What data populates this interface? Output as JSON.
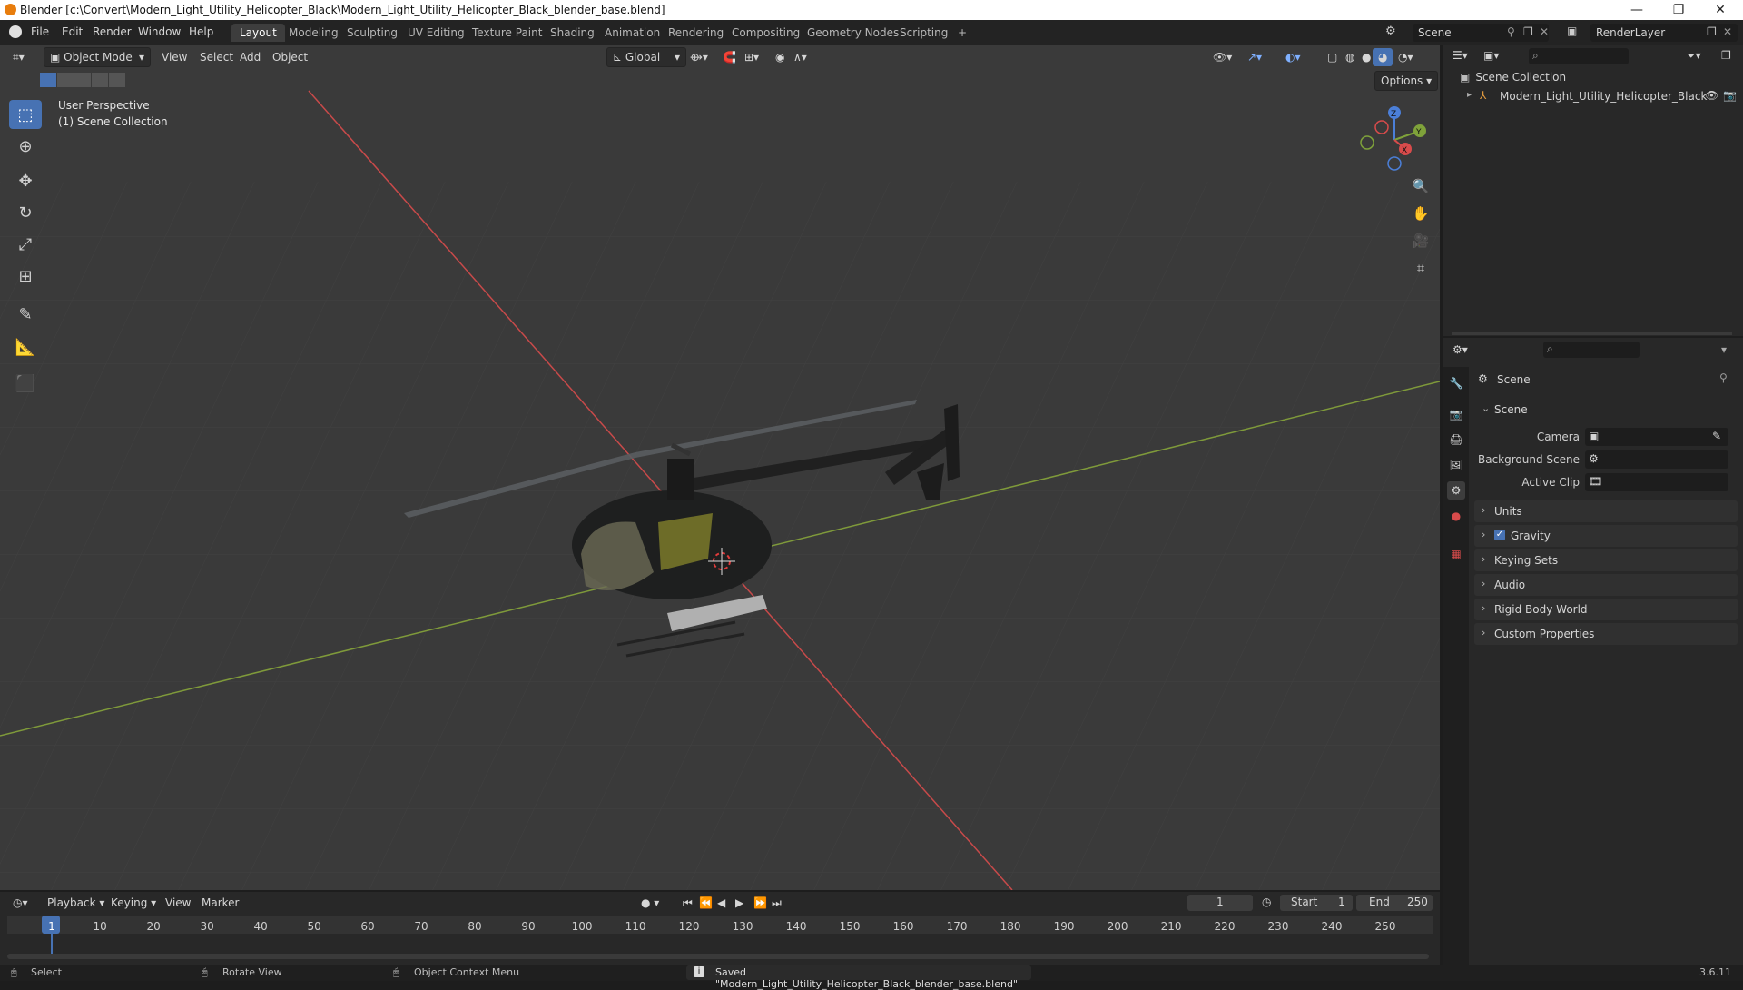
{
  "window": {
    "title": "Blender [c:\\Convert\\Modern_Light_Utility_Helicopter_Black\\Modern_Light_Utility_Helicopter_Black_blender_base.blend]",
    "min": "—",
    "max": "❐",
    "close": "✕"
  },
  "menu": [
    "File",
    "Edit",
    "Render",
    "Window",
    "Help"
  ],
  "workspaces": [
    "Layout",
    "Modeling",
    "Sculpting",
    "UV Editing",
    "Texture Paint",
    "Shading",
    "Animation",
    "Rendering",
    "Compositing",
    "Geometry Nodes",
    "Scripting",
    "+"
  ],
  "scene_selector": {
    "value": "Scene"
  },
  "render_layer": {
    "value": "RenderLayer"
  },
  "viewport": {
    "mode": "Object Mode",
    "menus": [
      "View",
      "Select",
      "Add",
      "Object"
    ],
    "transform_orientation": "Global",
    "options": "Options",
    "overlay_line1": "User Perspective",
    "overlay_line2": "(1) Scene Collection",
    "gizmo": {
      "x": "X",
      "y": "Y",
      "z": "Z"
    }
  },
  "outliner": {
    "root": "Scene Collection",
    "items": [
      {
        "label": "Modern_Light_Utility_Helicopter_Black"
      }
    ]
  },
  "properties": {
    "header": "Scene",
    "section": "Scene",
    "fields": {
      "camera": "Camera",
      "background_scene": "Background Scene",
      "active_clip": "Active Clip"
    },
    "panels": [
      "Units",
      "Gravity",
      "Keying Sets",
      "Audio",
      "Rigid Body World",
      "Custom Properties"
    ],
    "gravity_checked": true
  },
  "timeline": {
    "menus": [
      "Playback",
      "Keying",
      "View",
      "Marker"
    ],
    "current_frame": "1",
    "start_label": "Start",
    "start": "1",
    "end_label": "End",
    "end": "250",
    "ticks": [
      "1",
      "10",
      "20",
      "30",
      "40",
      "50",
      "60",
      "70",
      "80",
      "90",
      "100",
      "110",
      "120",
      "130",
      "140",
      "150",
      "160",
      "170",
      "180",
      "190",
      "200",
      "210",
      "220",
      "230",
      "240",
      "250"
    ]
  },
  "status": {
    "select": "Select",
    "rotate": "Rotate View",
    "context": "Object Context Menu",
    "message": "Saved \"Modern_Light_Utility_Helicopter_Black_blender_base.blend\"",
    "version": "3.6.11"
  },
  "colors": {
    "accent": "#4772b3",
    "x_axis": "#d84b4b",
    "y_axis": "#7fa23a",
    "z_axis": "#4b7fd8"
  }
}
